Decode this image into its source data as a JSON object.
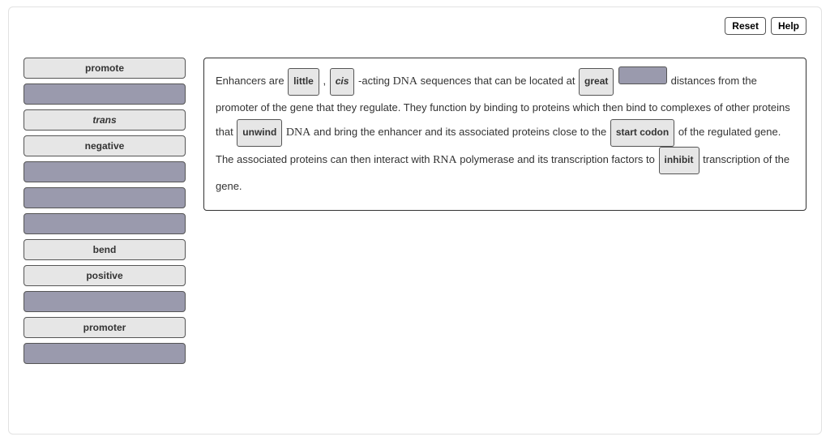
{
  "topbar": {
    "reset": "Reset",
    "help": "Help"
  },
  "bank": [
    {
      "label": "promote",
      "state": "filled"
    },
    {
      "label": "",
      "state": "empty"
    },
    {
      "label": "trans",
      "state": "filled",
      "style": "italic"
    },
    {
      "label": "negative",
      "state": "filled"
    },
    {
      "label": "",
      "state": "empty"
    },
    {
      "label": "",
      "state": "empty"
    },
    {
      "label": "",
      "state": "empty"
    },
    {
      "label": "bend",
      "state": "filled"
    },
    {
      "label": "positive",
      "state": "filled"
    },
    {
      "label": "",
      "state": "empty"
    },
    {
      "label": "promoter",
      "state": "filled"
    },
    {
      "label": "",
      "state": "empty"
    }
  ],
  "passage": {
    "t1": "Enhancers are ",
    "s1": "little",
    "t2": " , ",
    "s2": "cis",
    "t3": " -acting ",
    "dna1": "DNA",
    "t4": " sequences that can be located at ",
    "s3": "great",
    "t5": " distances from the promoter of the gene that they regulate. They function by binding to proteins which then bind to complexes of other proteins that ",
    "s4": "unwind",
    "t6": " ",
    "dna2": "DNA",
    "t7": " and bring the enhancer and its associated proteins close to the ",
    "s5": "start codon",
    "t8": " of the regulated gene. The associated proteins can then interact with ",
    "rna": "RNA",
    "t9": " polymerase and its transcription factors to ",
    "s6": "inhibit",
    "t10": " transcription of the gene."
  }
}
